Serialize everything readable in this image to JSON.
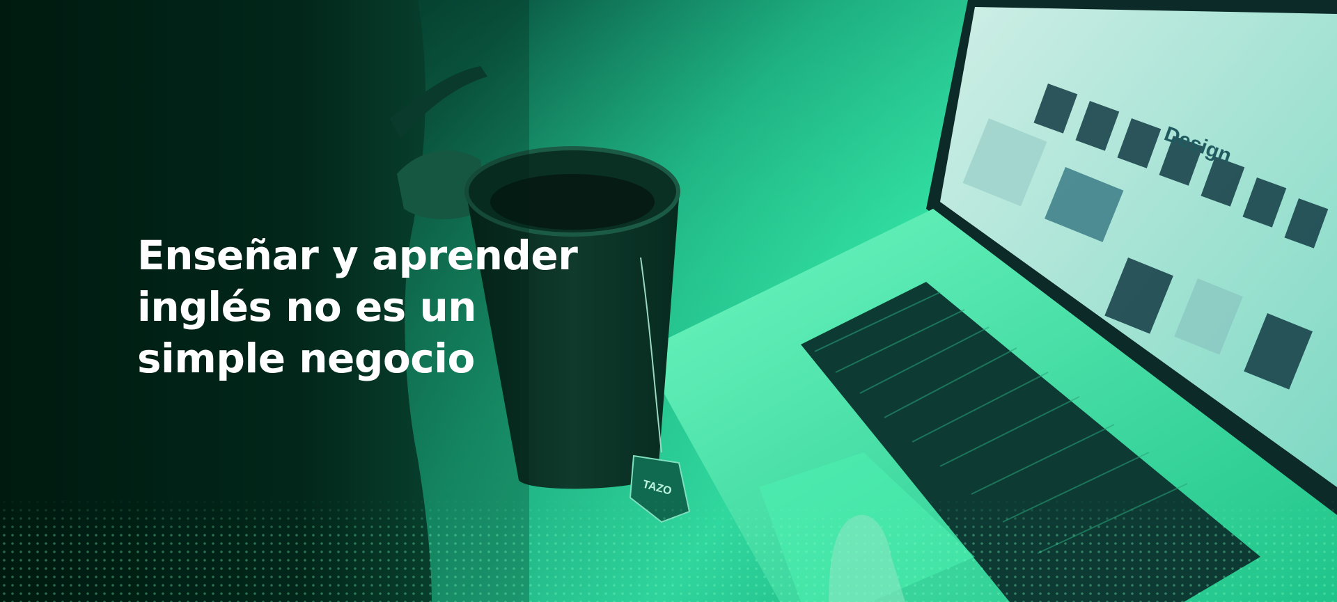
{
  "hero": {
    "headline_lines": [
      "Enseñar y aprender",
      "inglés no es un",
      "simple negocio"
    ],
    "screen_heading": "Design",
    "teabag_label": "TAZO",
    "colors": {
      "accent_green": "#22e39a",
      "dark_green": "#00301f",
      "text": "#ffffff"
    }
  }
}
